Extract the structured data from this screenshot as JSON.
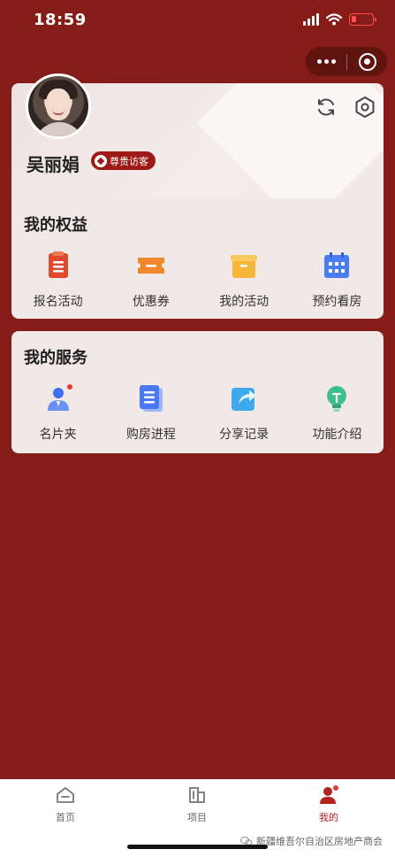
{
  "status_bar": {
    "time": "18:59"
  },
  "profile": {
    "name": "吴丽娟",
    "badge": "尊贵访客"
  },
  "benefits": {
    "title": "我的权益",
    "items": [
      {
        "label": "报名活动",
        "icon": "registration-clipboard-icon"
      },
      {
        "label": "优惠券",
        "icon": "coupon-icon"
      },
      {
        "label": "我的活动",
        "icon": "activity-box-icon"
      },
      {
        "label": "预约看房",
        "icon": "calendar-icon"
      }
    ]
  },
  "services": {
    "title": "我的服务",
    "items": [
      {
        "label": "名片夹",
        "icon": "business-card-person-icon"
      },
      {
        "label": "购房进程",
        "icon": "document-list-icon"
      },
      {
        "label": "分享记录",
        "icon": "share-icon"
      },
      {
        "label": "功能介绍",
        "icon": "lightbulb-icon"
      }
    ]
  },
  "tab_bar": {
    "tabs": [
      {
        "label": "首页",
        "icon": "home-icon"
      },
      {
        "label": "项目",
        "icon": "building-icon"
      },
      {
        "label": "我的",
        "icon": "profile-icon",
        "active": true
      }
    ]
  },
  "watermark": {
    "text": "新疆维吾尔自治区房地产商会"
  },
  "colors": {
    "background": "#861c17",
    "accent": "#b4221c",
    "card": "#f1e8e8"
  }
}
